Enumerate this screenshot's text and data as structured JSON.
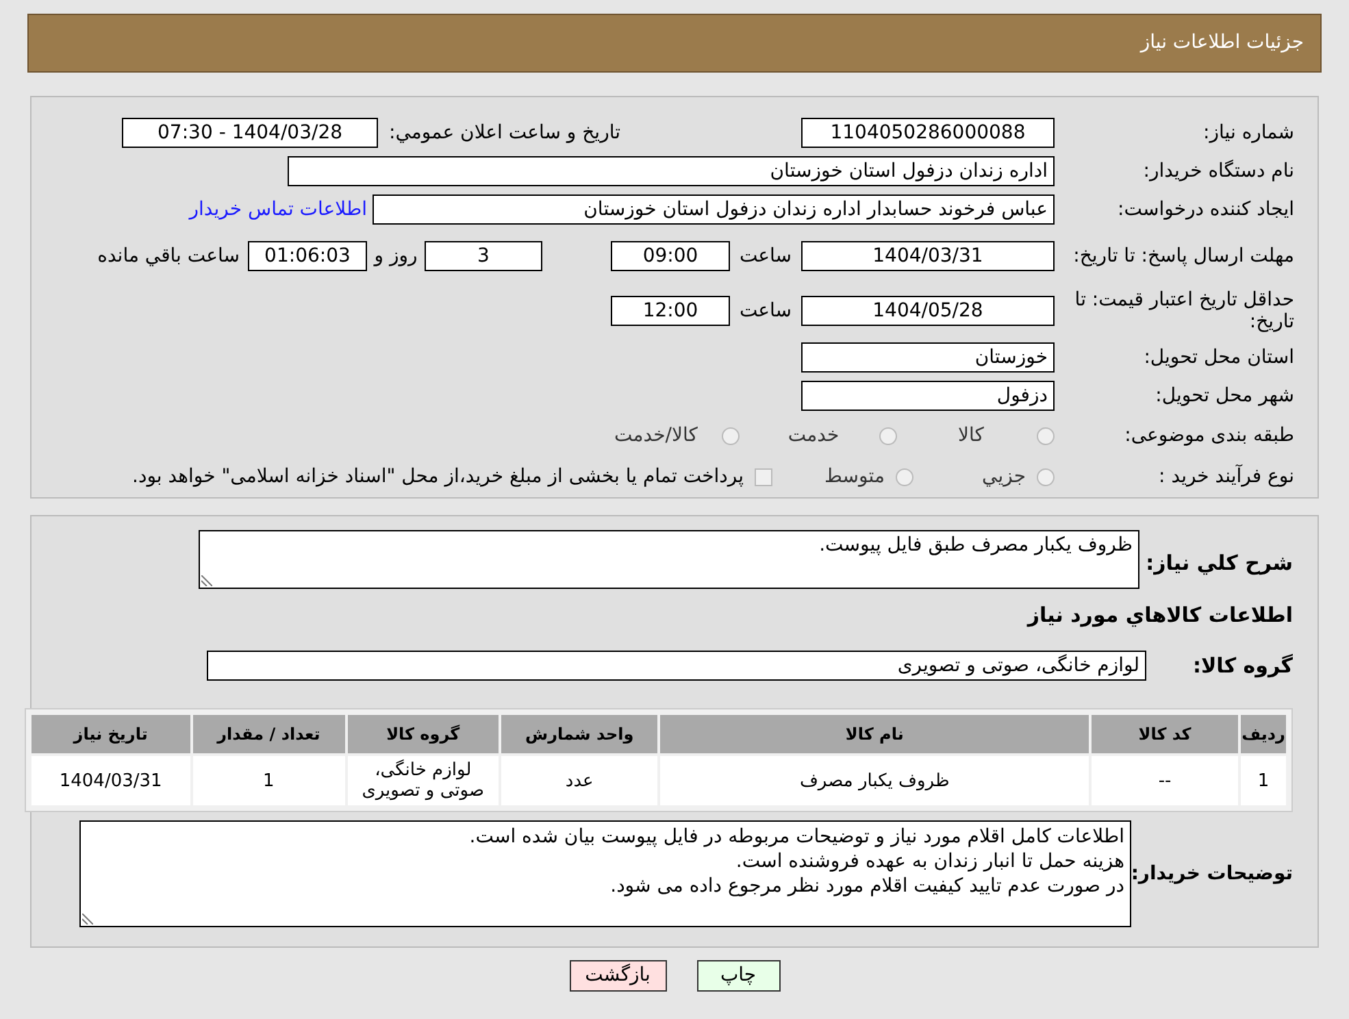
{
  "header": {
    "title": "جزئیات اطلاعات نیاز"
  },
  "details": {
    "need_number": {
      "label": "شماره نياز:",
      "value": "1104050286000088"
    },
    "announce": {
      "label": "تاريخ و ساعت اعلان عمومي:",
      "value": "1404/03/28 - 07:30"
    },
    "buyer_org": {
      "label": "نام دستگاه خريدار:",
      "value": "اداره زندان دزفول استان خوزستان"
    },
    "requester": {
      "label": "ايجاد کننده درخواست:",
      "value": "عباس فرخوند حسابدار اداره زندان دزفول استان خوزستان",
      "link": "اطلاعات تماس خريدار"
    },
    "deadline": {
      "label": "مهلت ارسال پاسخ: تا تاريخ:",
      "date": "1404/03/31",
      "time_label": "ساعت",
      "time": "09:00",
      "days": "3",
      "days_label": "روز و",
      "remaining": "01:06:03",
      "remaining_label": "ساعت باقي مانده"
    },
    "validity": {
      "label": "حداقل تاريخ اعتبار قيمت: تا تاريخ:",
      "date": "1404/05/28",
      "time_label": "ساعت",
      "time": "12:00"
    },
    "province": {
      "label": "استان محل تحويل:",
      "value": "خوزستان"
    },
    "city": {
      "label": "شهر محل تحويل:",
      "value": "دزفول"
    },
    "category": {
      "label": "طبقه بندی موضوعی:",
      "options": [
        {
          "label": "کالا",
          "selected": false
        },
        {
          "label": "خدمت",
          "selected": false
        },
        {
          "label": "کالا/خدمت",
          "selected": false
        }
      ]
    },
    "purchase_type": {
      "label": "نوع فرآیند خرید :",
      "options": [
        {
          "label": "جزيي",
          "selected": false
        },
        {
          "label": "متوسط",
          "selected": false
        }
      ],
      "payment": {
        "label": "پرداخت تمام یا بخشی از مبلغ خرید،از محل \"اسناد خزانه اسلامی\" خواهد بود.",
        "checked": false
      }
    }
  },
  "items": {
    "description": {
      "label": "شرح کلي نياز:",
      "value": "ظروف یکبار مصرف طبق فایل پیوست."
    },
    "heading": "اطلاعات کالاهاي مورد نياز",
    "group": {
      "label": "گروه کالا:",
      "value": "لوازم خانگی، صوتی و تصویری"
    },
    "table": {
      "columns": [
        "ردیف",
        "کد کالا",
        "نام کالا",
        "واحد شمارش",
        "گروه کالا",
        "تعداد / مقدار",
        "تاریخ نیاز"
      ],
      "rows": [
        [
          "1",
          "--",
          "ظروف یکبار مصرف",
          "عدد",
          "لوازم خانگی، صوتی و تصویری",
          "1",
          "1404/03/31"
        ]
      ]
    },
    "notes": {
      "label": "توضیحات خریدار:",
      "lines": [
        "اطلاعات کامل اقلام مورد نیاز و توضیحات مربوطه در فایل پیوست بیان شده است.",
        "هزینه حمل تا انبار زندان به عهده فروشنده است.",
        "در صورت عدم تایید کیفیت اقلام مورد نظر مرجوع داده می شود."
      ]
    }
  },
  "buttons": [
    {
      "label": "چاپ",
      "kind": "print"
    },
    {
      "label": "بازگشت",
      "kind": "back"
    }
  ]
}
